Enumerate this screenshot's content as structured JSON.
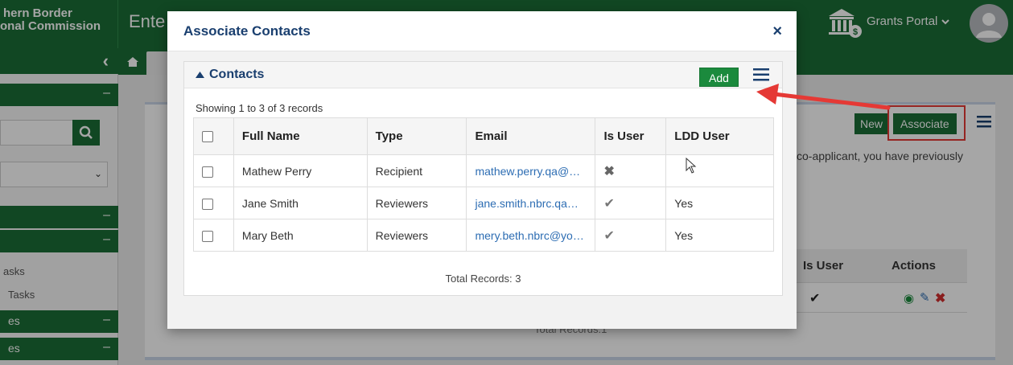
{
  "app": {
    "brand_line1": "hern Border",
    "brand_line2": "onal Commission",
    "title_fragment": "Ente",
    "portal_menu": "Grants Portal"
  },
  "sidebar": {
    "links": [
      "asks",
      "Tasks"
    ],
    "headers": [
      "es",
      "es"
    ]
  },
  "background": {
    "new_label": "New",
    "associate_label": "Associate",
    "body_text": "co-applicant, you have previously",
    "table_headers": [
      "Is User",
      "Actions"
    ],
    "total_fragment": "Total Records:1"
  },
  "modal": {
    "title": "Associate Contacts",
    "close": "×",
    "panel": {
      "title": "Contacts",
      "add_label": "Add",
      "showing": "Showing 1 to 3 of 3 records",
      "columns": [
        "Full Name",
        "Type",
        "Email",
        "Is User",
        "LDD User"
      ],
      "rows": [
        {
          "name": "Mathew Perry",
          "type": "Recipient",
          "email": "mathew.perry.qa@…",
          "is_user": "✖",
          "ldd_user": ""
        },
        {
          "name": "Jane Smith",
          "type": "Reviewers",
          "email": "jane.smith.nbrc.qa…",
          "is_user": "✔",
          "ldd_user": "Yes"
        },
        {
          "name": "Mary Beth",
          "type": "Reviewers",
          "email": "mery.beth.nbrc@yo…",
          "is_user": "✔",
          "ldd_user": "Yes"
        }
      ],
      "total": "Total Records: 3"
    }
  },
  "colors": {
    "brand_green": "#1b6e36",
    "title_blue": "#1a3f6f",
    "link_blue": "#2d6db3",
    "annotation_red": "#e53935"
  }
}
